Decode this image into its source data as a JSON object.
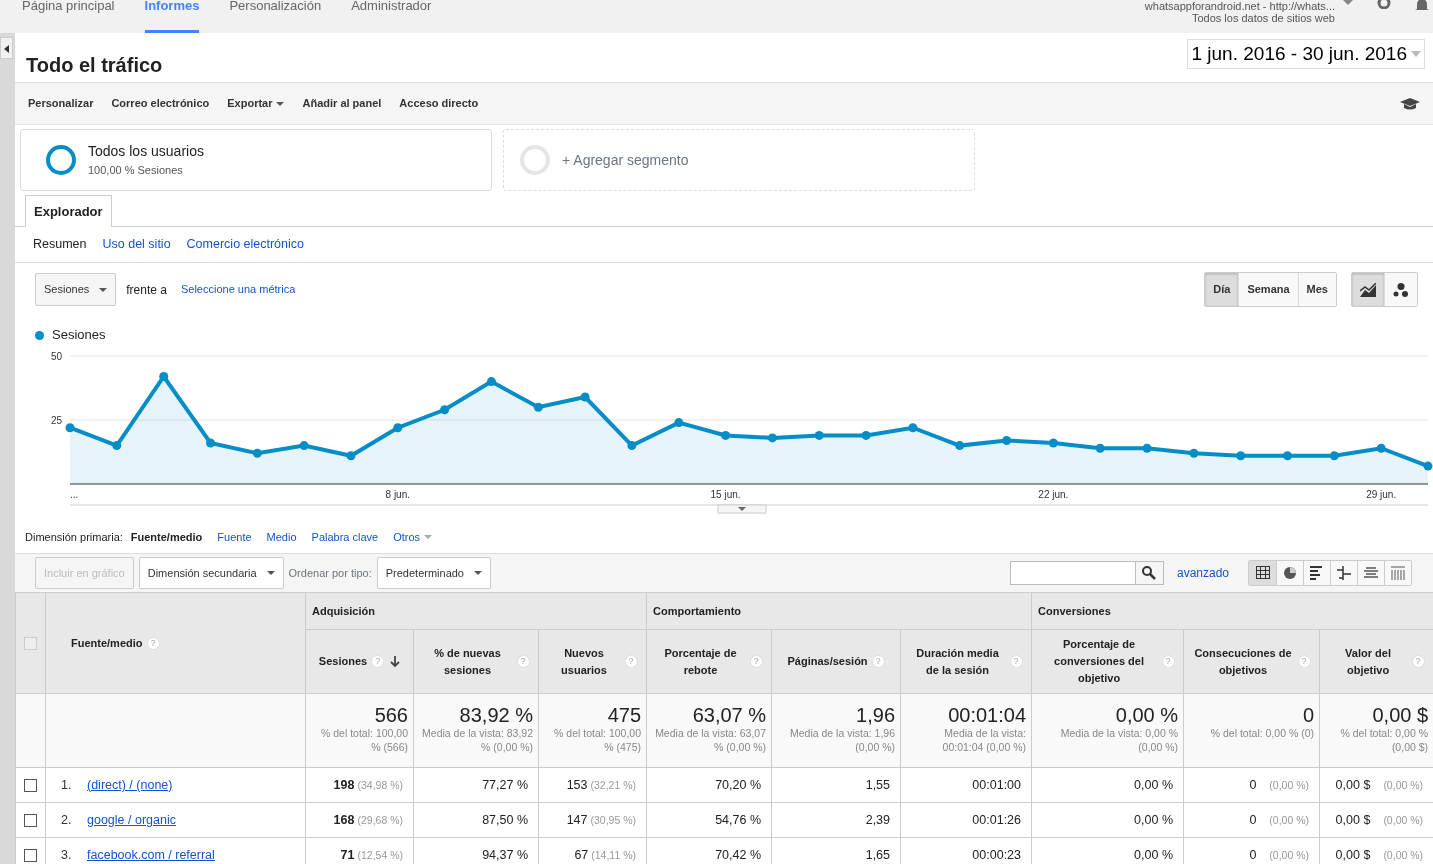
{
  "top_nav": {
    "items": [
      {
        "label": "Página principal",
        "selected": false
      },
      {
        "label": "Informes",
        "selected": true
      },
      {
        "label": "Personalización",
        "selected": false
      },
      {
        "label": "Administrador",
        "selected": false
      }
    ],
    "account": {
      "site": "whatsappforandroid.net - http://whats...",
      "view": "Todos los datos de sitios web"
    }
  },
  "report": {
    "title": "Todo el tráfico",
    "date_range": "1 jun. 2016 - 30 jun. 2016"
  },
  "toolbar": [
    {
      "label": "Personalizar",
      "dropdown": false
    },
    {
      "label": "Correo electrónico",
      "dropdown": false
    },
    {
      "label": "Exportar",
      "dropdown": true
    },
    {
      "label": "Añadir al panel",
      "dropdown": false
    },
    {
      "label": "Acceso directo",
      "dropdown": false
    }
  ],
  "segments": [
    {
      "kind": "segment",
      "title": "Todos los usuarios",
      "subtitle": "100,00 % Sesiones"
    },
    {
      "kind": "add",
      "title": "+ Agregar segmento"
    }
  ],
  "tabs": [
    {
      "label": "Explorador",
      "selected": true
    }
  ],
  "subtabs": [
    {
      "label": "Resumen",
      "selected": true
    },
    {
      "label": "Uso del sitio",
      "selected": false
    },
    {
      "label": "Comercio electrónico",
      "selected": false
    }
  ],
  "metric": {
    "value": "Sesiones",
    "vs_label": "frente a",
    "vs_link": "Seleccione una métrica"
  },
  "granularity": [
    {
      "label": "Día",
      "selected": true
    },
    {
      "label": "Semana",
      "selected": false
    },
    {
      "label": "Mes",
      "selected": false
    }
  ],
  "chart_modes": [
    {
      "kind": "line",
      "selected": true
    },
    {
      "kind": "motion",
      "selected": false
    }
  ],
  "chart": {
    "chart_data": {
      "type": "area",
      "series": [
        {
          "name": "Sesiones",
          "color": "#058dc7",
          "values": [
            22,
            15,
            42,
            16,
            12,
            15,
            11,
            22,
            29,
            40,
            30,
            34,
            15,
            24,
            19,
            18,
            19,
            19,
            22,
            15,
            17,
            16,
            14,
            14,
            12,
            11,
            11,
            11,
            14,
            7
          ]
        }
      ],
      "categories": [
        "...",
        null,
        null,
        null,
        null,
        null,
        null,
        "8 jun.",
        null,
        null,
        null,
        null,
        null,
        null,
        "15 jun.",
        null,
        null,
        null,
        null,
        null,
        null,
        "22 jun.",
        null,
        null,
        null,
        null,
        null,
        null,
        "29 jun.",
        null
      ],
      "yticks": [
        25,
        50
      ],
      "ylim": [
        0,
        50
      ]
    }
  },
  "primary_dimension": {
    "label": "Dimensión primaria:",
    "options": [
      {
        "label": "Fuente/medio",
        "selected": true,
        "dropdown": false
      },
      {
        "label": "Fuente",
        "selected": false,
        "dropdown": false
      },
      {
        "label": "Medio",
        "selected": false,
        "dropdown": false
      },
      {
        "label": "Palabra clave",
        "selected": false,
        "dropdown": false
      },
      {
        "label": "Otros",
        "selected": false,
        "dropdown": true
      }
    ]
  },
  "table_toolbar": {
    "include_button": {
      "label": "Incluir en gráfico",
      "disabled": true
    },
    "secondary_dimension": "Dimensión secundaria",
    "sort_label": "Ordenar por tipo:",
    "sort_value": "Predeterminado",
    "advanced": "avanzado",
    "views": [
      {
        "kind": "table",
        "selected": true
      },
      {
        "kind": "pie",
        "selected": false
      },
      {
        "kind": "bars",
        "selected": false
      },
      {
        "kind": "comparison",
        "selected": false
      },
      {
        "kind": "term-cloud",
        "selected": false
      },
      {
        "kind": "pivot",
        "selected": false
      }
    ]
  },
  "table": {
    "select_all": {
      "checked": false
    },
    "groups": [
      {
        "label": "Adquisición"
      },
      {
        "label": "Comportamiento"
      },
      {
        "label": "Conversiones"
      }
    ],
    "dimension_column": {
      "label": "Fuente/medio",
      "help": "?"
    },
    "columns": [
      {
        "label": "Sesiones",
        "help": "?",
        "sorted": true
      },
      {
        "label": "% de nuevas sesiones",
        "help": "?",
        "sorted": false
      },
      {
        "label": "Nuevos usuarios",
        "help": "?",
        "sorted": false
      },
      {
        "label": "Porcentaje de rebote",
        "help": "?",
        "sorted": false
      },
      {
        "label": "Páginas/sesión",
        "help": "?",
        "sorted": false
      },
      {
        "label": "Duración media de la sesión",
        "help": "?",
        "sorted": false
      },
      {
        "label": "Porcentaje de conversiones del objetivo",
        "help": "?",
        "sorted": false
      },
      {
        "label": "Consecuciones de objetivos",
        "help": "?",
        "sorted": false
      },
      {
        "label": "Valor del objetivo",
        "help": "?",
        "sorted": false
      }
    ],
    "totals": [
      {
        "value": "566",
        "note": "% del total: 100,00 % (566)"
      },
      {
        "value": "83,92 %",
        "note": "Media de la vista: 83,92 % (0,00 %)"
      },
      {
        "value": "475",
        "note": "% del total: 100,00 % (475)"
      },
      {
        "value": "63,07 %",
        "note": "Media de la vista: 63,07 % (0,00 %)"
      },
      {
        "value": "1,96",
        "note": "Media de la vista: 1,96 (0,00 %)"
      },
      {
        "value": "00:01:04",
        "note": "Media de la vista: 00:01:04 (0,00 %)"
      },
      {
        "value": "0,00 %",
        "note": "Media de la vista: 0,00 % (0,00 %)"
      },
      {
        "value": "0",
        "note": "% del total: 0,00 % (0)"
      },
      {
        "value": "0,00 $",
        "note": "% del total: 0,00 % (0,00 $)"
      }
    ],
    "rows": [
      {
        "index": "1.",
        "source": "(direct) / (none)",
        "checked": false,
        "cells": [
          {
            "value": "198",
            "share": "(34,98 %)"
          },
          {
            "value": "77,27 %"
          },
          {
            "value": "153",
            "share": "(32,21 %)"
          },
          {
            "value": "70,20 %"
          },
          {
            "value": "1,55"
          },
          {
            "value": "00:01:00"
          },
          {
            "value": "0,00 %"
          },
          {
            "value": "0",
            "share": "(0,00 %)"
          },
          {
            "value": "0,00 $",
            "share": "(0,00 %)"
          }
        ]
      },
      {
        "index": "2.",
        "source": "google / organic",
        "checked": false,
        "cells": [
          {
            "value": "168",
            "share": "(29,68 %)"
          },
          {
            "value": "87,50 %"
          },
          {
            "value": "147",
            "share": "(30,95 %)"
          },
          {
            "value": "54,76 %"
          },
          {
            "value": "2,39"
          },
          {
            "value": "00:01:26"
          },
          {
            "value": "0,00 %"
          },
          {
            "value": "0",
            "share": "(0,00 %)"
          },
          {
            "value": "0,00 $",
            "share": "(0,00 %)"
          }
        ]
      },
      {
        "index": "3.",
        "source": "facebook.com / referral",
        "checked": false,
        "cells": [
          {
            "value": "71",
            "share": "(12,54 %)"
          },
          {
            "value": "94,37 %"
          },
          {
            "value": "67",
            "share": "(14,11 %)"
          },
          {
            "value": "70,42 %"
          },
          {
            "value": "1,65"
          },
          {
            "value": "00:00:23"
          },
          {
            "value": "0,00 %"
          },
          {
            "value": "0",
            "share": "(0,00 %)"
          },
          {
            "value": "0,00 $",
            "share": "(0,00 %)"
          }
        ]
      }
    ]
  }
}
